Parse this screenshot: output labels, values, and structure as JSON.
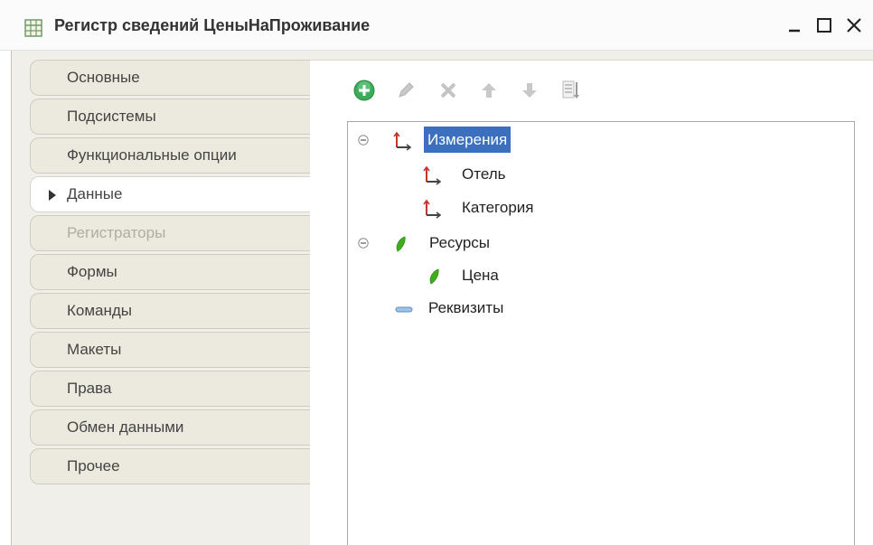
{
  "window": {
    "title": "Регистр сведений ЦеныНаПроживание",
    "title_icon": "register-table-icon",
    "buttons": {
      "minimize": "minimize-icon",
      "maximize": "maximize-icon",
      "close": "close-icon"
    }
  },
  "tabs": [
    {
      "label": "Основные",
      "state": "normal"
    },
    {
      "label": "Подсистемы",
      "state": "normal"
    },
    {
      "label": "Функциональные опции",
      "state": "normal"
    },
    {
      "label": "Данные",
      "state": "active"
    },
    {
      "label": "Регистраторы",
      "state": "disabled"
    },
    {
      "label": "Формы",
      "state": "normal"
    },
    {
      "label": "Команды",
      "state": "normal"
    },
    {
      "label": "Макеты",
      "state": "normal"
    },
    {
      "label": "Права",
      "state": "normal"
    },
    {
      "label": "Обмен данными",
      "state": "normal"
    },
    {
      "label": "Прочее",
      "state": "normal"
    }
  ],
  "toolbar": {
    "buttons": [
      "add-icon",
      "edit-icon",
      "delete-icon",
      "move-up-icon",
      "move-down-icon",
      "sort-list-icon"
    ]
  },
  "tree": {
    "nodes": [
      {
        "label": "Измерения",
        "type": "dimensions-group",
        "selected": true,
        "expanded": true
      },
      {
        "label": "Отель",
        "type": "dimension"
      },
      {
        "label": "Категория",
        "type": "dimension"
      },
      {
        "label": "Ресурсы",
        "type": "resources-group",
        "expanded": true
      },
      {
        "label": "Цена",
        "type": "resource"
      },
      {
        "label": "Реквизиты",
        "type": "attributes-group"
      }
    ]
  },
  "colors": {
    "selection": "#3d6fbf",
    "tab_bg": "#ece9de",
    "resource_green": "#3fae1e",
    "dimension_red": "#c0392b",
    "add_green": "#3cab5a"
  }
}
